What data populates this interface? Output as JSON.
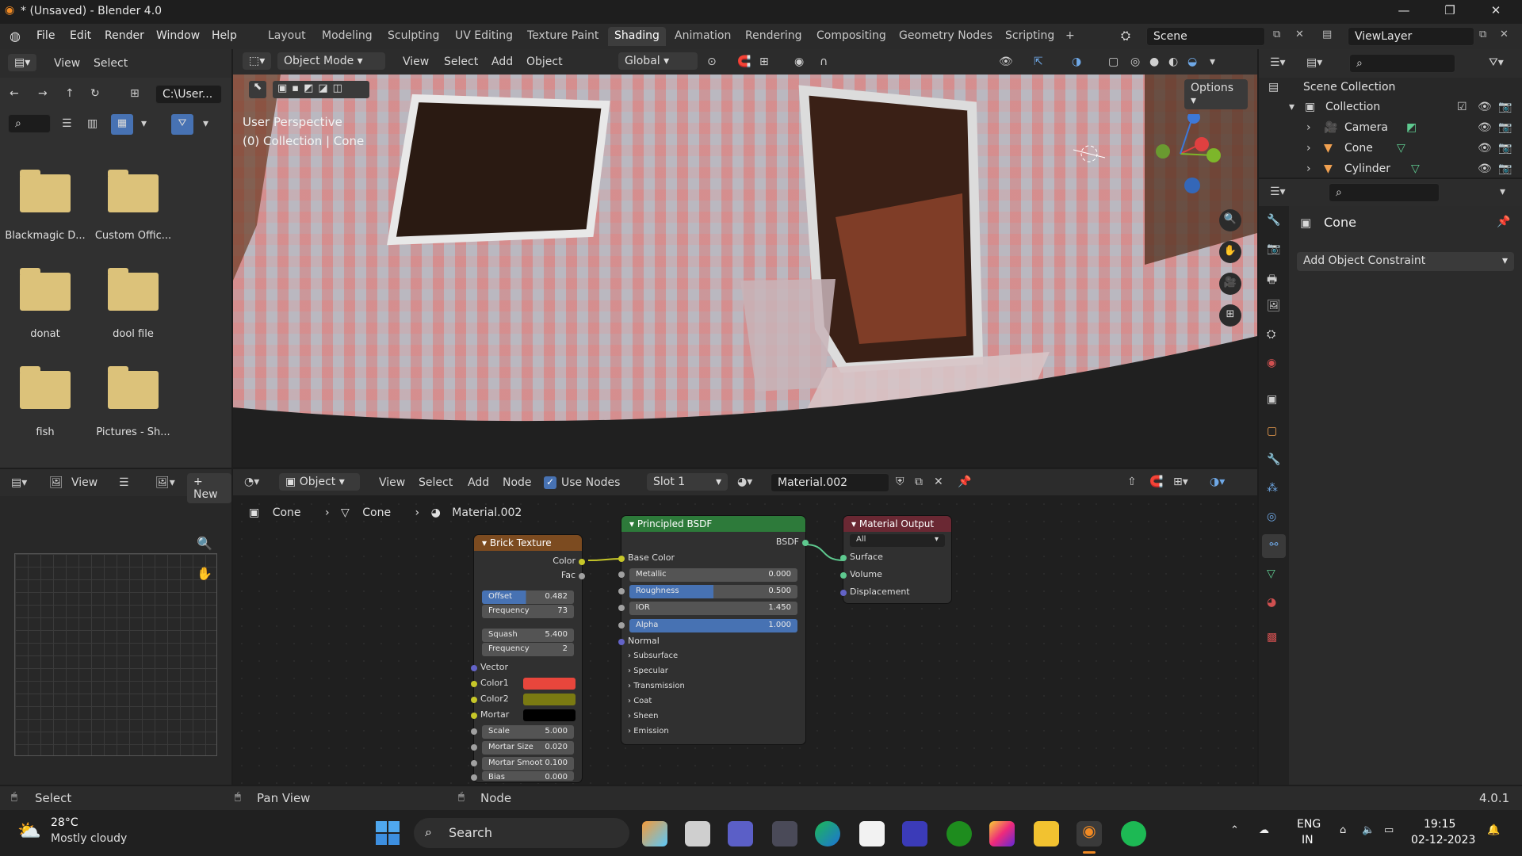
{
  "titlebar": {
    "title": "* (Unsaved) - Blender 4.0"
  },
  "menu": {
    "items": [
      "File",
      "Edit",
      "Render",
      "Window",
      "Help"
    ]
  },
  "workspaces": [
    "Layout",
    "Modeling",
    "Sculpting",
    "UV Editing",
    "Texture Paint",
    "Shading",
    "Animation",
    "Rendering",
    "Compositing",
    "Geometry Nodes",
    "Scripting"
  ],
  "active_workspace": "Shading",
  "scene": {
    "label": "Scene"
  },
  "viewlayer": {
    "label": "ViewLayer"
  },
  "filebrowser": {
    "view": "View",
    "select": "Select",
    "path": "C:\\User...",
    "folders": [
      "Blackmagic D...",
      "Custom Offic...",
      "donat",
      "dool file",
      "fish",
      "Pictures - Sh..."
    ]
  },
  "viewport": {
    "mode": "Object Mode",
    "view": "View",
    "select": "Select",
    "add": "Add",
    "object": "Object",
    "orientation": "Global",
    "options": "Options",
    "overlay_line1": "User Perspective",
    "overlay_line2": "(0) Collection | Cone"
  },
  "outliner": {
    "scene_collection": "Scene Collection",
    "collection": "Collection",
    "items": [
      "Camera",
      "Cone",
      "Cylinder"
    ]
  },
  "properties": {
    "object_name": "Cone",
    "add_constraint": "Add Object Constraint"
  },
  "imageeditor": {
    "view": "View",
    "new": "New"
  },
  "nodeeditor": {
    "object": "Object",
    "view": "View",
    "select": "Select",
    "add": "Add",
    "node": "Node",
    "use_nodes": "Use Nodes",
    "slot": "Slot 1",
    "material": "Material.002",
    "breadcrumb": [
      "Cone",
      "Cone",
      "Material.002"
    ]
  },
  "brick": {
    "title": "Brick Texture",
    "out_color": "Color",
    "out_fac": "Fac",
    "offset_label": "Offset",
    "offset": "0.482",
    "freq1_label": "Frequency",
    "freq1": "73",
    "squash_label": "Squash",
    "squash": "5.400",
    "freq2_label": "Frequency",
    "freq2": "2",
    "vector": "Vector",
    "color1": "Color1",
    "color2": "Color2",
    "mortar": "Mortar",
    "scale_label": "Scale",
    "scale": "5.000",
    "msize_label": "Mortar Size",
    "msize": "0.020",
    "msmooth_label": "Mortar Smoot",
    "msmooth": "0.100",
    "bias_label": "Bias",
    "bias": "0.000",
    "color1_hex": "#e8463c",
    "color2_hex": "#7a7a12",
    "mortar_hex": "#000000"
  },
  "bsdf": {
    "title": "Principled BSDF",
    "out": "BSDF",
    "base_color": "Base Color",
    "metallic_label": "Metallic",
    "metallic": "0.000",
    "roughness_label": "Roughness",
    "roughness": "0.500",
    "ior_label": "IOR",
    "ior": "1.450",
    "alpha_label": "Alpha",
    "alpha": "1.000",
    "normal": "Normal",
    "sections": [
      "Subsurface",
      "Specular",
      "Transmission",
      "Coat",
      "Sheen",
      "Emission"
    ]
  },
  "output": {
    "title": "Material Output",
    "target": "All",
    "surface": "Surface",
    "volume": "Volume",
    "displacement": "Displacement"
  },
  "status": {
    "left": "Select",
    "middle": "Pan View",
    "right": "Node",
    "version": "4.0.1"
  },
  "taskbar": {
    "temp": "28°C",
    "weather": "Mostly cloudy",
    "search": "Search",
    "lang1": "ENG",
    "lang2": "IN",
    "time": "19:15",
    "date": "02-12-2023"
  }
}
